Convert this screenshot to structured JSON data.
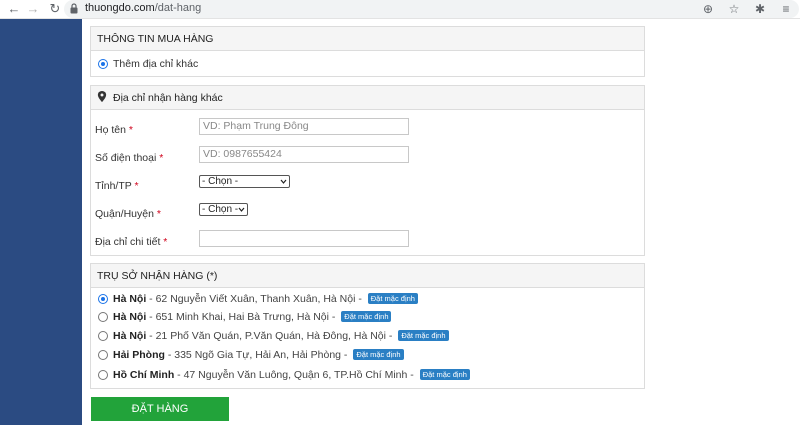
{
  "browser": {
    "url_host": "thuongdo.com",
    "url_path": "/dat-hang"
  },
  "section_purchase": {
    "title": "THÔNG TIN MUA HÀNG",
    "option_label": "Thêm địa chỉ khác"
  },
  "section_address": {
    "title": "Địa chỉ nhận hàng khác",
    "fields": {
      "name_label": "Họ tên",
      "name_placeholder": "VD: Phạm Trung Đông",
      "phone_label": "Số điện thoại",
      "phone_placeholder": "VD: 0987655424",
      "province_label": "Tỉnh/TP",
      "province_value": "- Chọn -",
      "district_label": "Quận/Huyện",
      "district_value": "- Chọn -",
      "detail_label": "Địa chỉ chi tiết",
      "required_mark": "*"
    }
  },
  "section_office": {
    "title": "TRỤ SỞ NHẬN HÀNG (*)",
    "default_badge": "Đặt mặc định",
    "offices": [
      {
        "city": "Hà Nội",
        "address": " - 62 Nguyễn Viết Xuân, Thanh Xuân, Hà Nội - ",
        "selected": true
      },
      {
        "city": "Hà Nội",
        "address": " - 651 Minh Khai, Hai Bà Trưng, Hà Nội - ",
        "selected": false
      },
      {
        "city": "Hà Nội",
        "address": " - 21 Phố Văn Quán, P.Văn Quán, Hà Đông, Hà Nội - ",
        "selected": false
      },
      {
        "city": "Hải Phòng",
        "address": " - 335 Ngõ Gia Tự, Hải An, Hải Phòng - ",
        "selected": false
      },
      {
        "city": "Hồ Chí Minh",
        "address": " - 47 Nguyễn Văn Luông, Quận 6, TP.Hồ Chí Minh - ",
        "selected": false
      }
    ]
  },
  "submit_label": "ĐẶT HÀNG",
  "colors": {
    "sidebar": "#2b4b82",
    "badge": "#2a7fc4",
    "submit": "#22a33a",
    "required": "#d0021b"
  }
}
